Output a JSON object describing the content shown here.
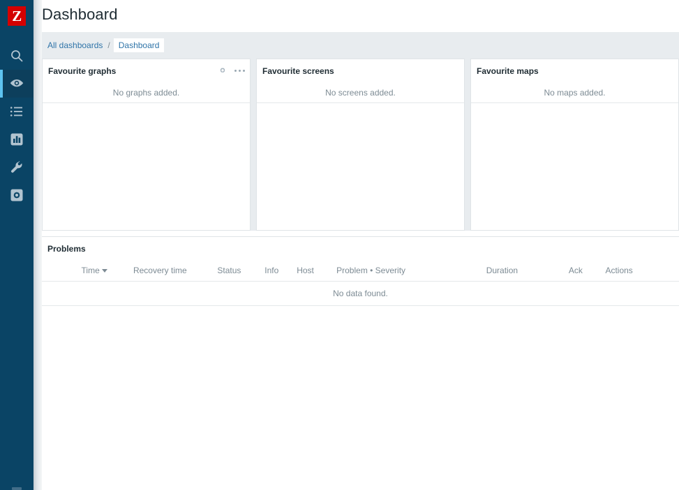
{
  "app": {
    "logo_letter": "Z",
    "logo_color": "#d40000",
    "sidebar_color": "#0a4465",
    "accent_color": "#5ec3f0",
    "link_color": "#2f74a8",
    "band_color": "#e8ecef"
  },
  "header": {
    "title": "Dashboard"
  },
  "sidebar": {
    "items": [
      {
        "name": "search",
        "icon": "search-icon",
        "active": false
      },
      {
        "name": "monitoring",
        "icon": "eye-icon",
        "active": true
      },
      {
        "name": "inventory",
        "icon": "list-icon",
        "active": false
      },
      {
        "name": "reports",
        "icon": "bar-chart-icon",
        "active": false
      },
      {
        "name": "configuration",
        "icon": "wrench-icon",
        "active": false
      },
      {
        "name": "administration",
        "icon": "gear-square-icon",
        "active": false
      }
    ]
  },
  "breadcrumb": {
    "parent": "All dashboards",
    "separator": "/",
    "current": "Dashboard"
  },
  "widgets": [
    {
      "title": "Favourite graphs",
      "empty_text": "No graphs added.",
      "has_actions": true,
      "actions": [
        "gear-icon",
        "ellipsis-icon"
      ]
    },
    {
      "title": "Favourite screens",
      "empty_text": "No screens added.",
      "has_actions": false,
      "actions": []
    },
    {
      "title": "Favourite maps",
      "empty_text": "No maps added.",
      "has_actions": false,
      "actions": []
    }
  ],
  "problems": {
    "title": "Problems",
    "columns": [
      {
        "label": "Time",
        "sorted": true,
        "sort_dir": "desc"
      },
      {
        "label": "Recovery time",
        "sorted": false
      },
      {
        "label": "Status",
        "sorted": false
      },
      {
        "label": "Info",
        "sorted": false
      },
      {
        "label": "Host",
        "sorted": false
      },
      {
        "label": "Problem • Severity",
        "sorted": false
      },
      {
        "label": "Duration",
        "sorted": false
      },
      {
        "label": "Ack",
        "sorted": false
      },
      {
        "label": "Actions",
        "sorted": false
      }
    ],
    "rows": [],
    "empty_text": "No data found."
  }
}
